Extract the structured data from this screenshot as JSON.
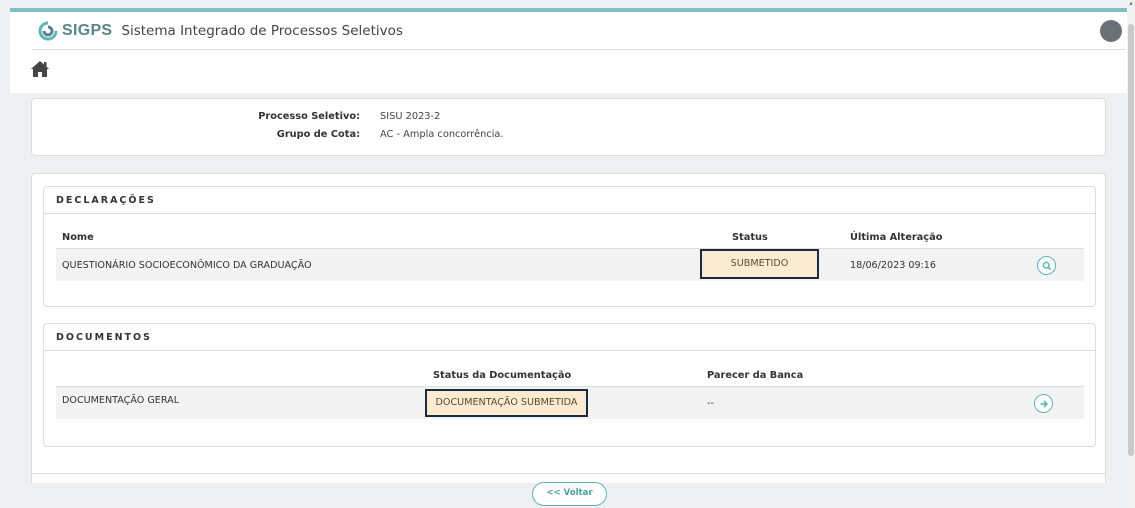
{
  "header": {
    "logo_text": "SIGPS",
    "app_title": "Sistema Integrado de Processos Seletivos"
  },
  "info": {
    "processo_label": "Processo Seletivo:",
    "processo_value": "SISU 2023-2",
    "grupo_label": "Grupo de Cota:",
    "grupo_value": "AC - Ampla concorrência."
  },
  "declaracoes": {
    "title": "DECLARAÇÕES",
    "columns": [
      "Nome",
      "Status",
      "Última Alteração"
    ],
    "rows": [
      {
        "nome": "QUESTIONÁRIO SOCIOECONÔMICO DA GRADUAÇÃO",
        "status": "SUBMETIDO",
        "ultima_alteracao": "18/06/2023 09:16",
        "action_icon": "search-icon"
      }
    ]
  },
  "documentos": {
    "title": "DOCUMENTOS",
    "columns": [
      "Status da Documentação",
      "Parecer da Banca"
    ],
    "rows": [
      {
        "nome": "DOCUMENTAÇÃO GERAL",
        "status": "DOCUMENTAÇÃO SUBMETIDA",
        "parecer": "--",
        "action_icon": "arrow-right-icon"
      }
    ]
  },
  "footer": {
    "back_label": "<< Voltar"
  },
  "colors": {
    "accent": "#5fb5b5",
    "badge_bg": "#fbebd0",
    "badge_border": "#1b2a44",
    "top_line": "#7fc1c5"
  }
}
